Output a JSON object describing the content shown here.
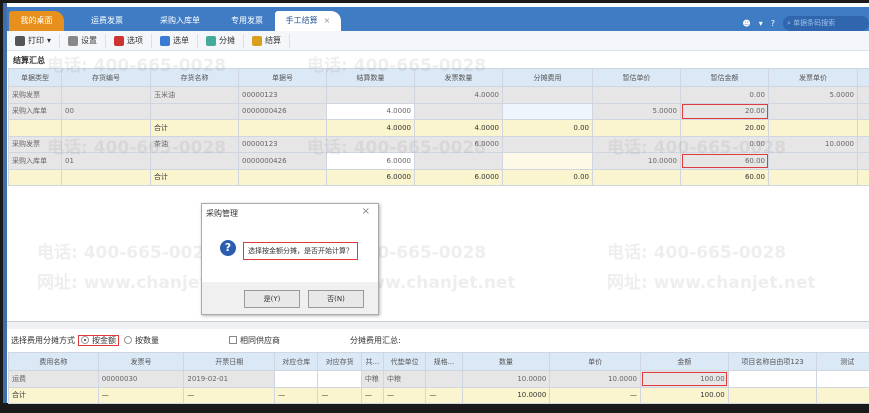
{
  "tabs": [
    {
      "label": "我的桌面"
    },
    {
      "label": "运费发票"
    },
    {
      "label": "采购入库单"
    },
    {
      "label": "专用发票"
    },
    {
      "label": "手工结算",
      "close": "×"
    }
  ],
  "search_placeholder": "单据条码搜索",
  "toolbar": [
    {
      "label": "打印",
      "icon": "printer-icon"
    },
    {
      "label": "设置",
      "icon": "gear-icon"
    },
    {
      "label": "选项",
      "icon": "options-icon"
    },
    {
      "label": "选单",
      "icon": "select-doc-icon"
    },
    {
      "label": "分摊",
      "icon": "allocate-icon"
    },
    {
      "label": "结算",
      "icon": "settle-icon"
    }
  ],
  "summary_label": "结算汇总",
  "top_table": {
    "headers": [
      "单据类型",
      "存货编号",
      "存货名称",
      "单据号",
      "结算数量",
      "发票数量",
      "分摊费用",
      "暂估单价",
      "暂估金额",
      "发票单价",
      ""
    ],
    "rows": [
      [
        "采购发票",
        "",
        "玉米油",
        "00000123",
        "",
        "4.0000",
        "",
        "",
        "0.00",
        "5.0000",
        ""
      ],
      [
        "采购入库单",
        "00",
        "",
        "0000000426",
        "4.0000",
        "",
        "",
        "5.0000",
        "20.00",
        "",
        ""
      ],
      [
        "",
        "",
        "合计",
        "",
        "4.0000",
        "4.0000",
        "0.00",
        "",
        "20.00",
        "",
        ""
      ],
      [
        "采购发票",
        "",
        "茶油",
        "00000123",
        "",
        "6.0000",
        "",
        "",
        "0.00",
        "10.0000",
        ""
      ],
      [
        "采购入库单",
        "01",
        "",
        "0000000426",
        "6.0000",
        "",
        "",
        "10.0000",
        "60.00",
        "",
        ""
      ],
      [
        "",
        "",
        "合计",
        "",
        "6.0000",
        "6.0000",
        "0.00",
        "",
        "60.00",
        "",
        ""
      ]
    ]
  },
  "method": {
    "label": "选择费用分摊方式",
    "by_amount": "按金额",
    "by_quantity": "按数量",
    "same_supplier": "相同供应商",
    "summary": "分摊费用汇总:"
  },
  "bottom_table": {
    "headers": [
      "费用名称",
      "发票号",
      "开票日期",
      "对应仓库",
      "对应存货",
      "共...",
      "代垫单位",
      "规格...",
      "数量",
      "单价",
      "金额",
      "项目名称自由项123",
      "测试"
    ],
    "rows": [
      [
        "运费",
        "00000030",
        "2019-02-01",
        "",
        "",
        "中粮",
        "中粮",
        "",
        "10.0000",
        "10.0000",
        "100.00",
        "",
        ""
      ],
      [
        "合计",
        "—",
        "—",
        "—",
        "—",
        "—",
        "—",
        "—",
        "10.0000",
        "—",
        "100.00",
        "",
        ""
      ]
    ]
  },
  "dialog": {
    "title": "采购管理",
    "message": "选择按金额分摊，是否开始计算？",
    "yes": "是(Y)",
    "no": "否(N)",
    "close": "×"
  },
  "watermark": {
    "phone": "电话: 400-665-0028",
    "site": "网址: www.chanjet.net"
  },
  "colors": {
    "tabbar": "#3f7cc4",
    "home_tab": "#e8901e",
    "highlight": "#e0393e"
  }
}
